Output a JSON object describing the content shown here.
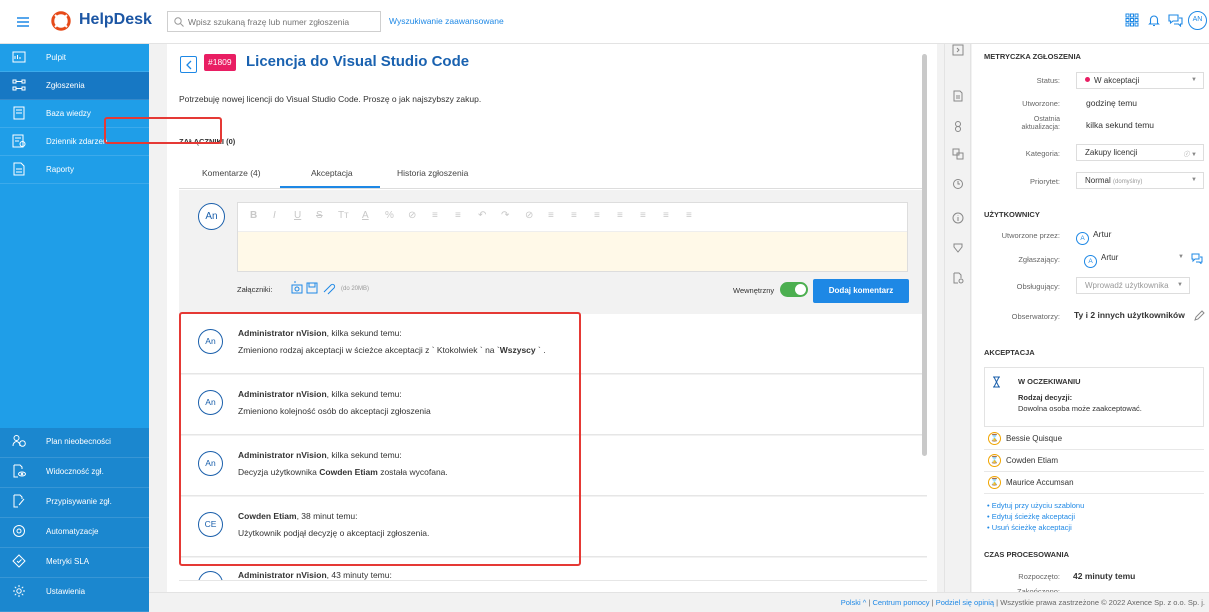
{
  "header": {
    "brand": "HelpDesk",
    "search_placeholder": "Wpisz szukaną frazę lub numer zgłoszenia",
    "advanced_search": "Wyszukiwanie zaawansowane",
    "user_initials": "AN"
  },
  "sidebar": {
    "items": [
      {
        "label": "Pulpit",
        "icon": "dashboard-icon"
      },
      {
        "label": "Zgłoszenia",
        "icon": "tickets-icon"
      },
      {
        "label": "Baza wiedzy",
        "icon": "knowledge-base-icon"
      },
      {
        "label": "Dziennik zdarzeń",
        "icon": "event-log-icon"
      },
      {
        "label": "Raporty",
        "icon": "reports-icon"
      }
    ],
    "lower_items": [
      {
        "label": "Plan nieobecności",
        "icon": "absence-icon"
      },
      {
        "label": "Widoczność zgł.",
        "icon": "visibility-icon"
      },
      {
        "label": "Przypisywanie zgł.",
        "icon": "assignment-icon"
      },
      {
        "label": "Automatyzacje",
        "icon": "automation-icon"
      },
      {
        "label": "Metryki SLA",
        "icon": "sla-icon"
      },
      {
        "label": "Ustawienia",
        "icon": "settings-icon"
      }
    ]
  },
  "ticket": {
    "number": "#1809",
    "title": "Licencja do Visual Studio Code",
    "description": "Potrzebuję nowej licencji do Visual Studio Code. Proszę o jak najszybszy zakup.",
    "attachments_header": "ZAŁĄCZNIKI (0)"
  },
  "tabs": [
    {
      "label": "Komentarze (4)"
    },
    {
      "label": "Akceptacja"
    },
    {
      "label": "Historia zgłoszenia"
    }
  ],
  "composer": {
    "avatar": "An",
    "attachments_label": "Załączniki:",
    "size_limit": "(do 20MB)",
    "internal_label": "Wewnętrzny",
    "internal_on": true,
    "submit_label": "Dodaj komentarz"
  },
  "comments": [
    {
      "avatar": "An",
      "author": "Administrator nVision",
      "time": ", kilka sekund temu:",
      "pre": "Zmieniono rodzaj akceptacji w ścieżce akceptacji z ` Ktokolwiek ` na `",
      "bold": "Wszyscy",
      "post": " ` ."
    },
    {
      "avatar": "An",
      "author": "Administrator nVision",
      "time": ", kilka sekund temu:",
      "pre": "Zmieniono kolejność osób do akceptacji zgłoszenia",
      "bold": "",
      "post": ""
    },
    {
      "avatar": "An",
      "author": "Administrator nVision",
      "time": ", kilka sekund temu:",
      "pre": "Decyzja użytkownika ",
      "bold": "Cowden Etiam",
      "post": " została wycofana."
    },
    {
      "avatar": "CE",
      "author": "Cowden Etiam",
      "time": ", 38 minut temu:",
      "pre": "Użytkownik podjął decyzję o akceptacji zgłoszenia.",
      "bold": "",
      "post": ""
    },
    {
      "avatar": "An",
      "author": "Administrator nVision",
      "time": ", 43 minuty temu:",
      "pre": "",
      "bold": "",
      "post": ""
    }
  ],
  "metrics": {
    "header": "METRYCZKA ZGŁOSZENIA",
    "status_label": "Status:",
    "status_value": "W akceptacji",
    "status_color": "#e91e63",
    "created_label": "Utworzone:",
    "created_value": "godzinę temu",
    "updated_label_1": "Ostatnia",
    "updated_label_2": "aktualizacja:",
    "updated_value": "kilka sekund temu",
    "category_label": "Kategoria:",
    "category_value": "Zakupy licencji",
    "priority_label": "Priorytet:",
    "priority_value": "Normal",
    "priority_note": "(domyślny)"
  },
  "users": {
    "header": "UŻYTKOWNICY",
    "created_by_label": "Utworzone przez:",
    "created_by": "Artur",
    "created_by_initial": "A",
    "reporter_label": "Zgłaszający:",
    "reporter": "Artur",
    "reporter_initial": "A",
    "handler_label": "Obsługujący:",
    "handler_placeholder": "Wprowadź użytkownika",
    "observers_label": "Obserwatorzy:",
    "observers_value": "Ty i 2 innych użytkowników"
  },
  "acceptance": {
    "header": "AKCEPTACJA",
    "state": "W OCZEKIWANIU",
    "decision_label": "Rodzaj decyzji:",
    "decision_text": "Dowolna osoba może zaakceptować.",
    "approvers": [
      "Bessie Quisque",
      "Cowden Etiam",
      "Maurice Accumsan"
    ],
    "links": [
      "• Edytuj przy użyciu szablonu",
      "• Edytuj ścieżkę akceptacji",
      "• Usuń ścieżkę akceptacji"
    ]
  },
  "processing": {
    "header": "CZAS PROCESOWANIA",
    "started_label": "Rozpoczęto:",
    "started_value": "42 minuty temu",
    "cut_label": "Zakończono:"
  },
  "footer": {
    "language": "Polski ^",
    "help": "Centrum pomocy",
    "feedback": "Podziel się opinią",
    "rights": "Wszystkie prawa zastrzeżone © 2022 Axence Sp. z o.o. Sp. j."
  },
  "colors": {
    "primary": "#1e88e5",
    "sidebar": "#1f9ee8",
    "highlight": "#e53935",
    "toggle": "#4caf50"
  }
}
